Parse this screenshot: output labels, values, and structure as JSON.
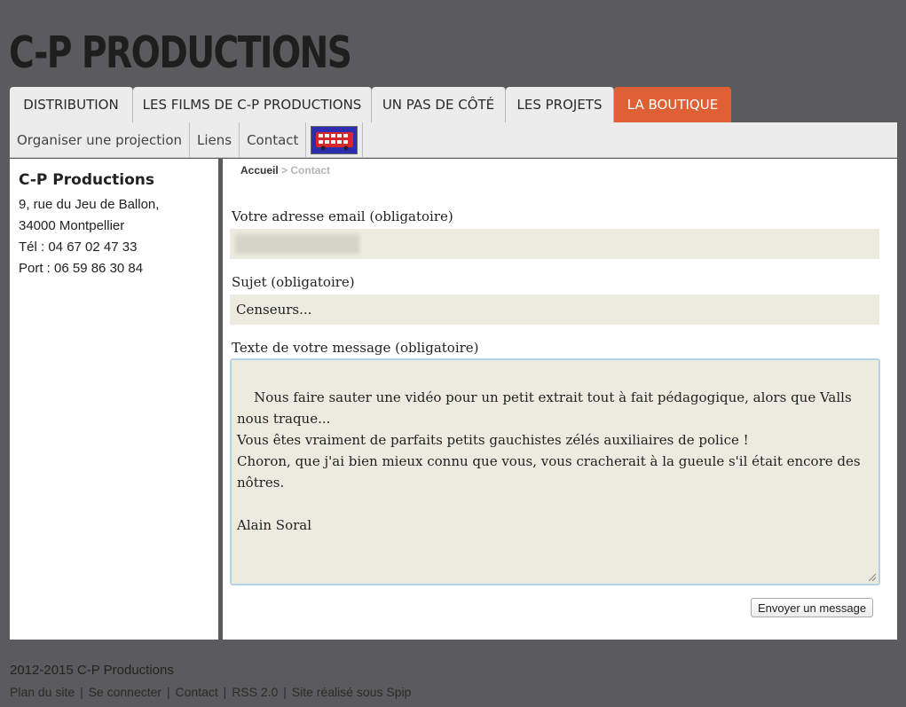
{
  "site": {
    "title": "C-P PRODUCTIONS"
  },
  "main_nav": [
    {
      "label": "DISTRIBUTION",
      "active": false
    },
    {
      "label": "LES FILMS DE C-P PRODUCTIONS",
      "active": false
    },
    {
      "label": "UN PAS DE CÔTÉ",
      "active": false
    },
    {
      "label": "LES PROJETS",
      "active": false
    },
    {
      "label": "LA BOUTIQUE",
      "active": true
    }
  ],
  "sub_nav": [
    {
      "label": "Organiser une projection"
    },
    {
      "label": "Liens"
    },
    {
      "label": "Contact"
    }
  ],
  "sidebar": {
    "name": "C-P Productions",
    "address_line1": "9, rue du Jeu de Ballon,",
    "address_line2": "34000 Montpellier",
    "phone": "Tél : 04 67 02 47 33",
    "mobile": "Port : 06 59 86 30 84"
  },
  "breadcrumb": {
    "home": "Accueil",
    "separator": ">",
    "current": "Contact"
  },
  "form": {
    "email_label": "Votre adresse email (obligatoire)",
    "email_value": "",
    "subject_label": "Sujet (obligatoire)",
    "subject_value": "Censeurs...",
    "message_label": "Texte de votre message (obligatoire)",
    "message_value": "Nous faire sauter une vidéo pour un petit extrait tout à fait pédagogique, alors que Valls nous traque...\nVous êtes vraiment de parfaits petits gauchistes zélés auxiliaires de police !\nChoron, que j'ai bien mieux connu que vous, vous cracherait à la gueule s'il était encore des nôtres.\n\nAlain Soral",
    "submit_label": "Envoyer un message"
  },
  "footer": {
    "copyright": "2012-2015 C-P Productions",
    "links": [
      "Plan du site",
      "Se connecter",
      "Contact",
      "RSS 2.0",
      "Site réalisé sous Spip"
    ],
    "separator": "|"
  },
  "colors": {
    "background": "#5b5b5d",
    "active_tab": "#e06036",
    "field_bg": "#ecebdf",
    "tab_bg": "#ececec"
  },
  "icons": {
    "sub_nav_image": "red-double-decker-bus"
  }
}
